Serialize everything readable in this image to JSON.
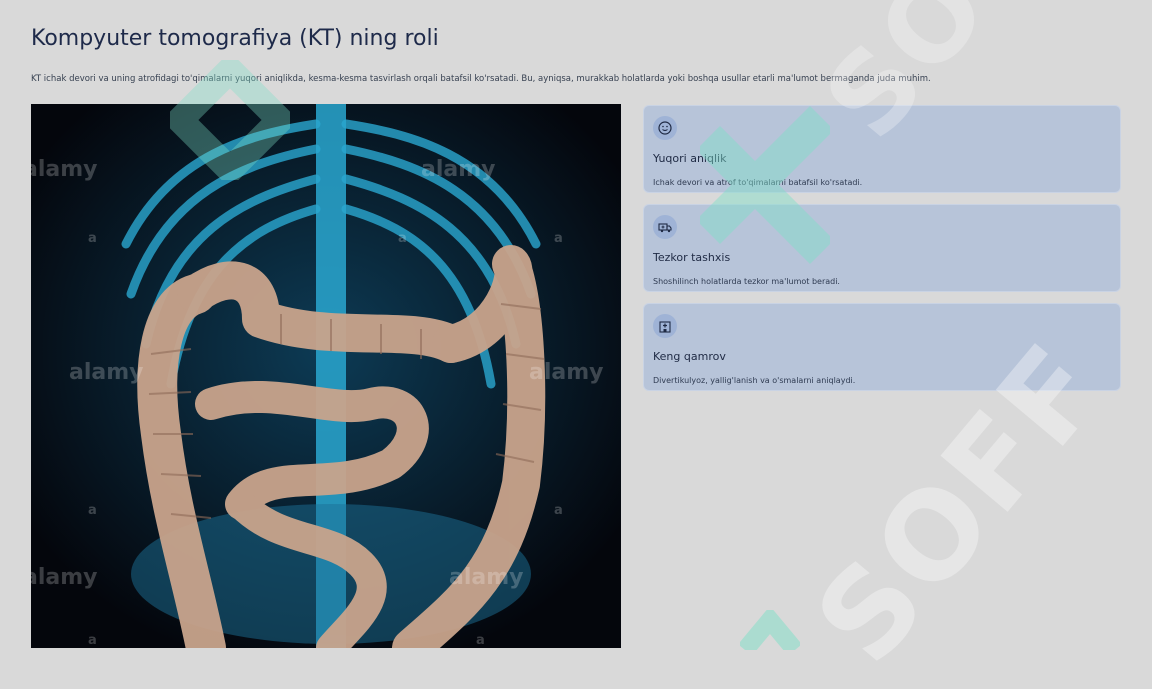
{
  "page": {
    "title": "Kompyuter tomografiya (KT) ning roli",
    "subtitle": "KT ichak devori va uning atrofidagi to'qimalarni yuqori aniqlikda, kesma-kesma tasvirlash orqali batafsil ko'rsatadi. Bu, ayniqsa, murakkab holatlarda yoki boshqa usullar etarli ma'lumot bermaganda juda muhim."
  },
  "image": {
    "watermark_text": "alamy",
    "small_mark": "a",
    "brand_watermark": "SOFF"
  },
  "cards": [
    {
      "icon": "smile-icon",
      "title": "Yuqori aniqlik",
      "description": "Ichak devori va atrof to'qimalarni batafsil ko'rsatadi."
    },
    {
      "icon": "ambulance-icon",
      "title": "Tezkor tashxis",
      "description": "Shoshilinch holatlarda tezkor ma'lumot beradi."
    },
    {
      "icon": "hospital-icon",
      "title": "Keng qamrov",
      "description": "Divertikulyoz, yallig'lanish va o'smalarni aniqlaydi."
    }
  ],
  "colors": {
    "background": "#d9d9d9",
    "card": "#b7c4d9",
    "title": "#1e2a4a",
    "bones": "#2aa7d0",
    "colon": "#c9a48c"
  }
}
